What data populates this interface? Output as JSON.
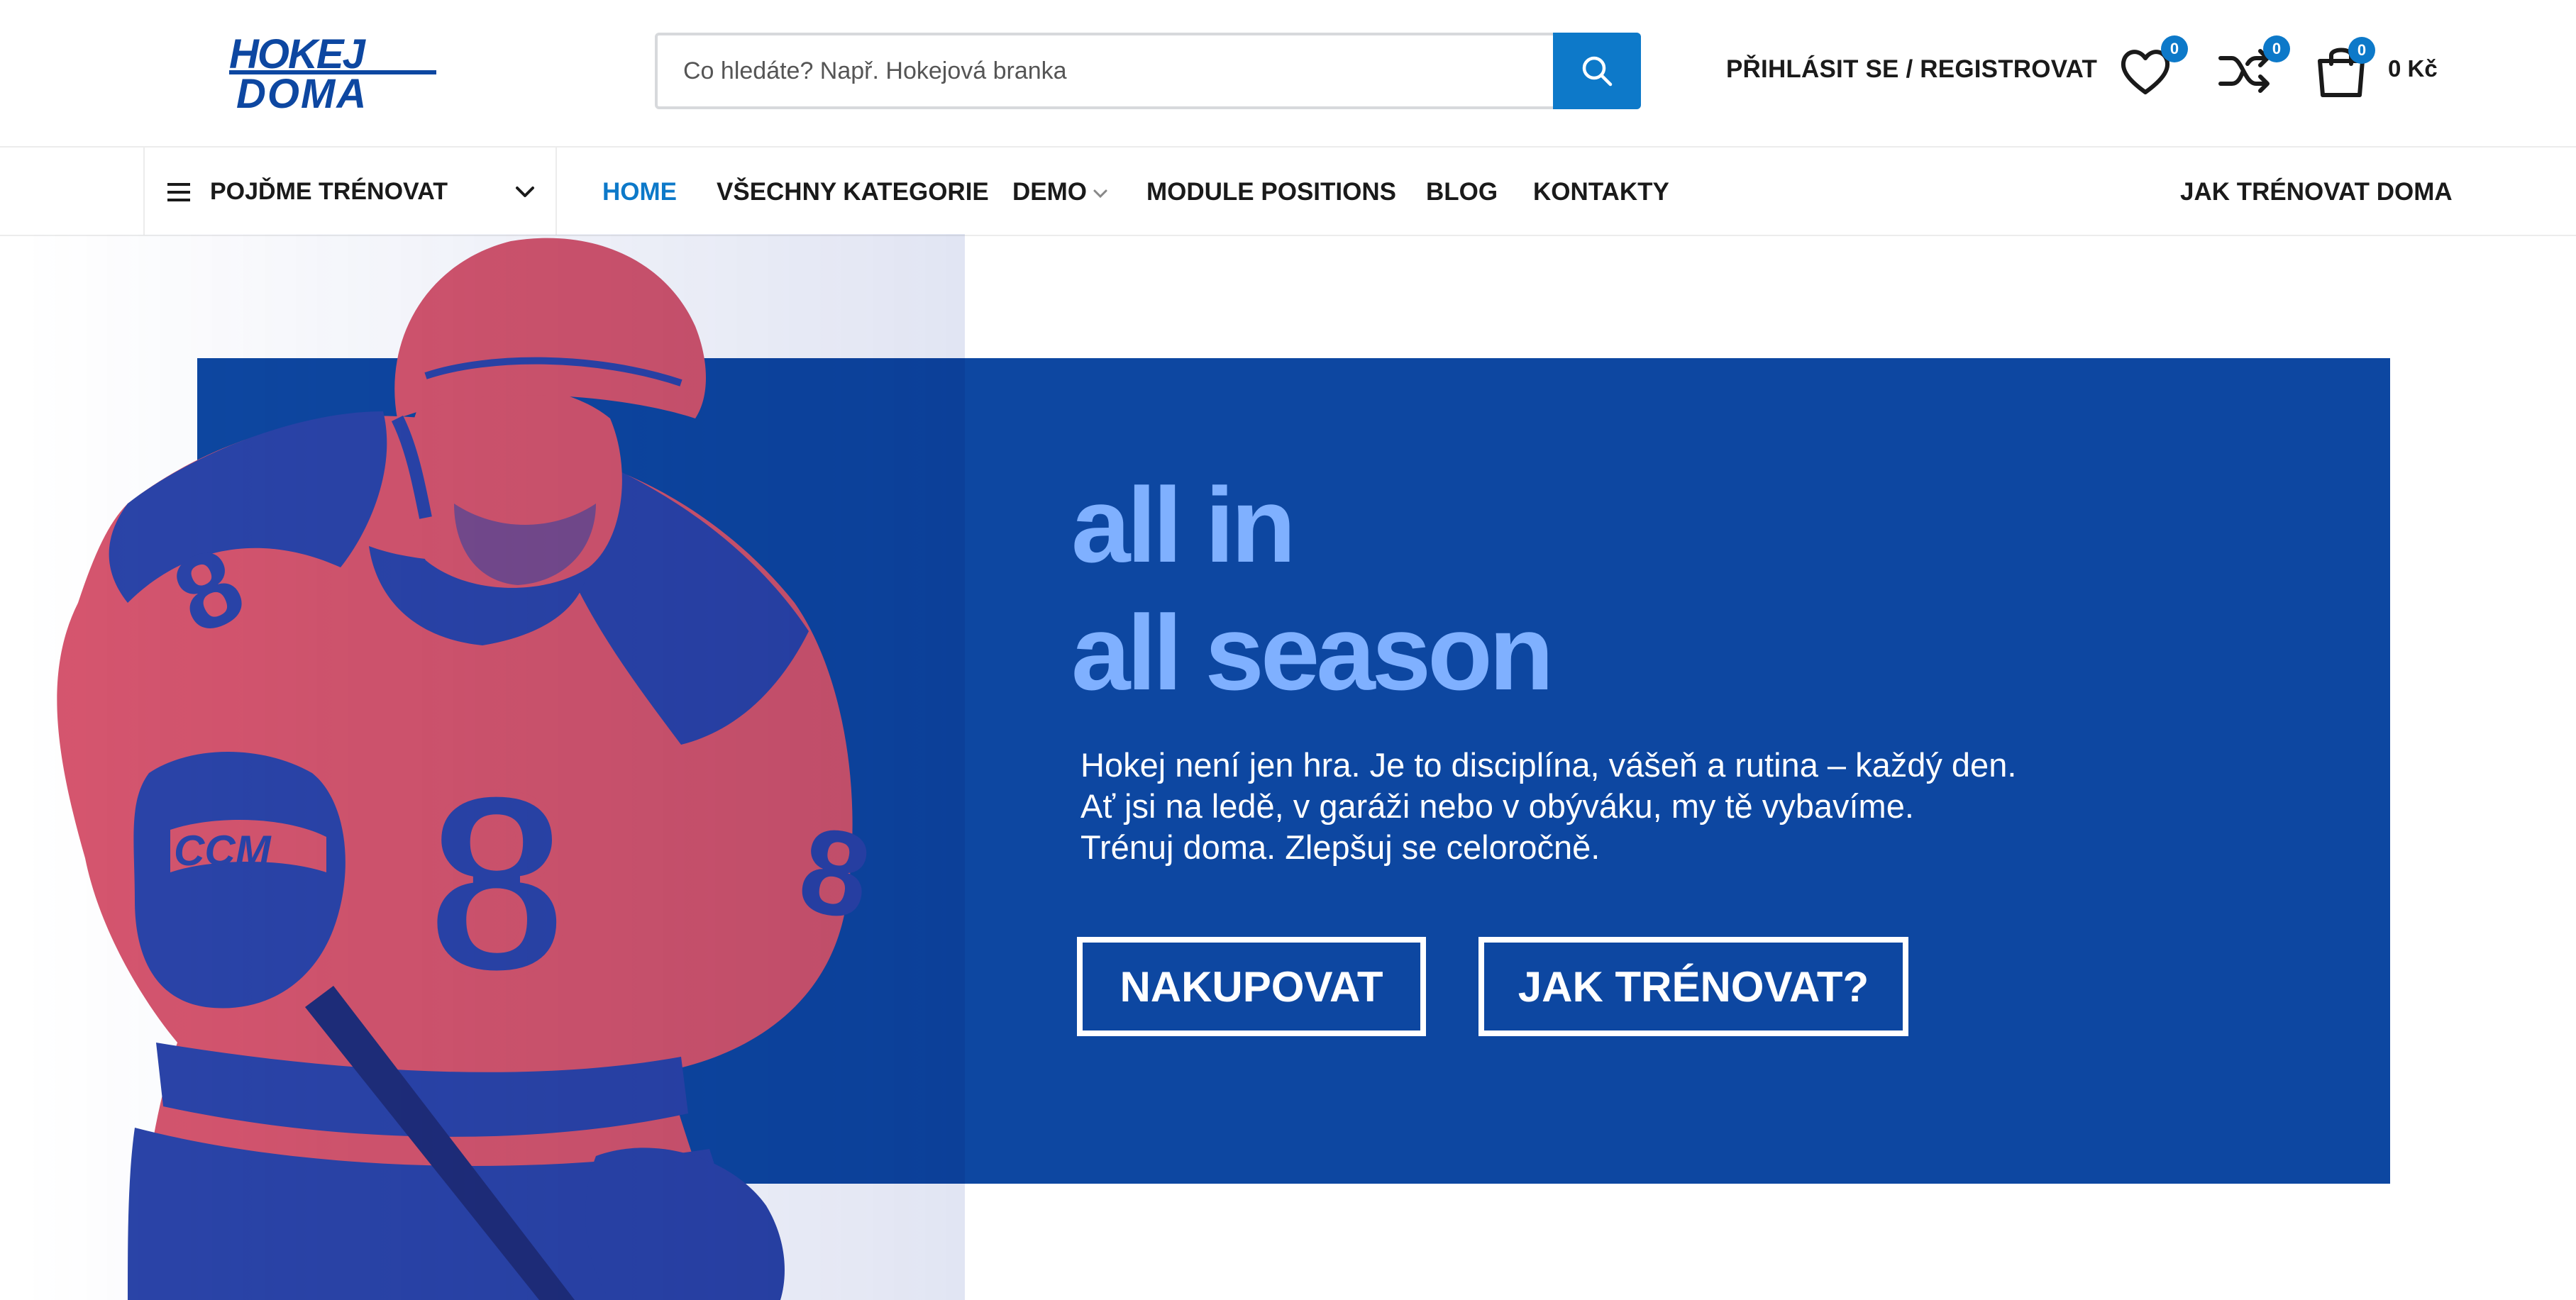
{
  "header": {
    "logo_text_line1": "HOKEJ",
    "logo_text_line2": "DOMA",
    "search": {
      "placeholder": "Co hledáte? Např. Hokejová branka",
      "value": ""
    },
    "login_label": "PŘIHLÁSIT SE / REGISTROVAT",
    "wishlist_count": "0",
    "compare_count": "0",
    "cart_count": "0",
    "cart_total": "0 Kč"
  },
  "nav": {
    "category_toggle_label": "POJĎME TRÉNOVAT",
    "items": [
      {
        "label": "HOME",
        "active": true
      },
      {
        "label": "VŠECHNY KATEGORIE"
      },
      {
        "label": "DEMO",
        "has_dropdown": true
      },
      {
        "label": "MODULE POSITIONS"
      },
      {
        "label": "BLOG"
      },
      {
        "label": "KONTAKTY"
      }
    ],
    "right_link": "JAK TRÉNOVAT DOMA"
  },
  "hero": {
    "headline_line1": "all in",
    "headline_line2": "all season",
    "description": [
      "Hokej není jen hra. Je to disciplína, vášeň a rutina – každý den.",
      "Ať jsi na ledě, v garáži nebo v obýváku, my tě vybavíme.",
      "Trénuj doma. Zlepšuj se celoročně."
    ],
    "primary_button": "NAKUPOVAT",
    "secondary_button": "JAK TRÉNOVAT?",
    "jersey_number": "8",
    "glove_brand": "CCM"
  },
  "colors": {
    "accent": "#0d79c9",
    "hero_blue": "#0d47a1",
    "headline": "#7fb0ff",
    "player_red": "#d6556e",
    "player_blue": "#2a44a8"
  },
  "icons": [
    "search-icon",
    "heart-icon",
    "shuffle-icon",
    "shopping-bag-icon",
    "hamburger-icon",
    "chevron-down-icon"
  ]
}
